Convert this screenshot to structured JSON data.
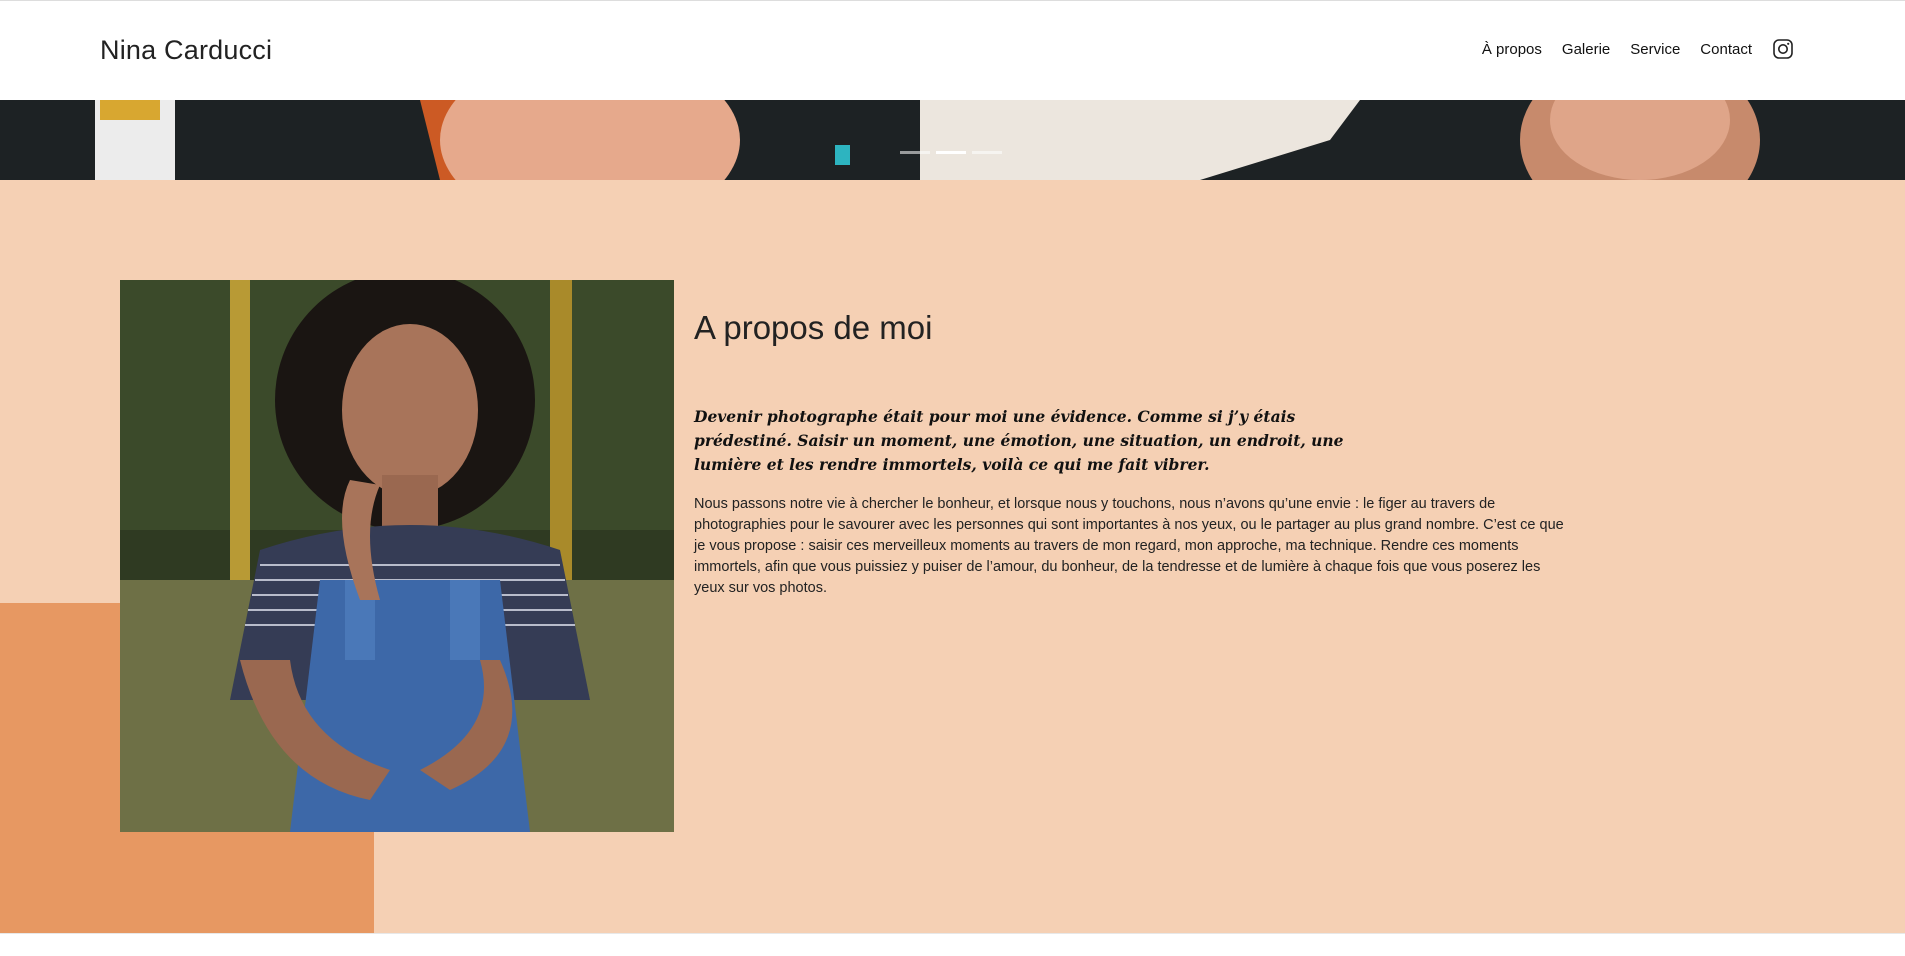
{
  "header": {
    "brand": "Nina Carducci",
    "nav": [
      {
        "label": "À propos"
      },
      {
        "label": "Galerie"
      },
      {
        "label": "Service"
      },
      {
        "label": "Contact"
      }
    ],
    "social_icon": "instagram-icon"
  },
  "hero": {
    "slides_count": 3,
    "active_slide": 2
  },
  "about": {
    "title": "A propos de moi",
    "quote": "Devenir photographe était pour moi une évidence. Comme si j’y étais prédestiné. Saisir un moment, une émotion, une situation, un endroit, une lumière et les rendre immortels, voilà ce qui me fait vibrer.",
    "paragraph": "Nous passons notre vie à chercher le bonheur, et lorsque nous y touchons, nous n’avons qu’une envie : le figer au travers de photographies pour le savourer avec les personnes qui sont importantes à nos yeux, ou le partager au plus grand nombre. C’est ce que je vous propose : saisir ces merveilleux moments au travers de mon regard, mon approche, ma technique. Rendre ces moments immortels, afin que vous puissiez y puiser de l’amour, du bonheur, de la tendresse et de lumière à chaque fois que vous poserez les yeux sur vos photos."
  },
  "colors": {
    "section_bg": "#f5d0b4",
    "accent_block": "#e79862",
    "header_bg": "#ffffff"
  }
}
